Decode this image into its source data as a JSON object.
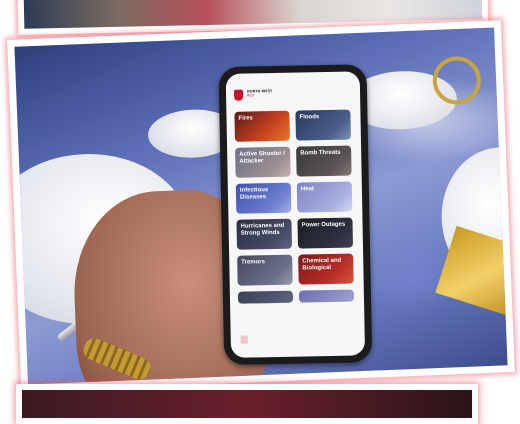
{
  "app": {
    "name": "NORTH WEST",
    "subtitle": "RED",
    "brand_color": "#c8102e"
  },
  "tiles": [
    {
      "label": "Fires"
    },
    {
      "label": "Floods"
    },
    {
      "label": "Active Shooter / Attacker"
    },
    {
      "label": "Bomb Threats"
    },
    {
      "label": "Infectious Diseases"
    },
    {
      "label": "Heat"
    },
    {
      "label": "Hurricanes and Strong Winds"
    },
    {
      "label": "Power Outages"
    },
    {
      "label": "Tremors"
    },
    {
      "label": "Chemical and Biological"
    }
  ],
  "icons": {
    "logo": "red-shield-icon",
    "bottom": "document-icon"
  }
}
